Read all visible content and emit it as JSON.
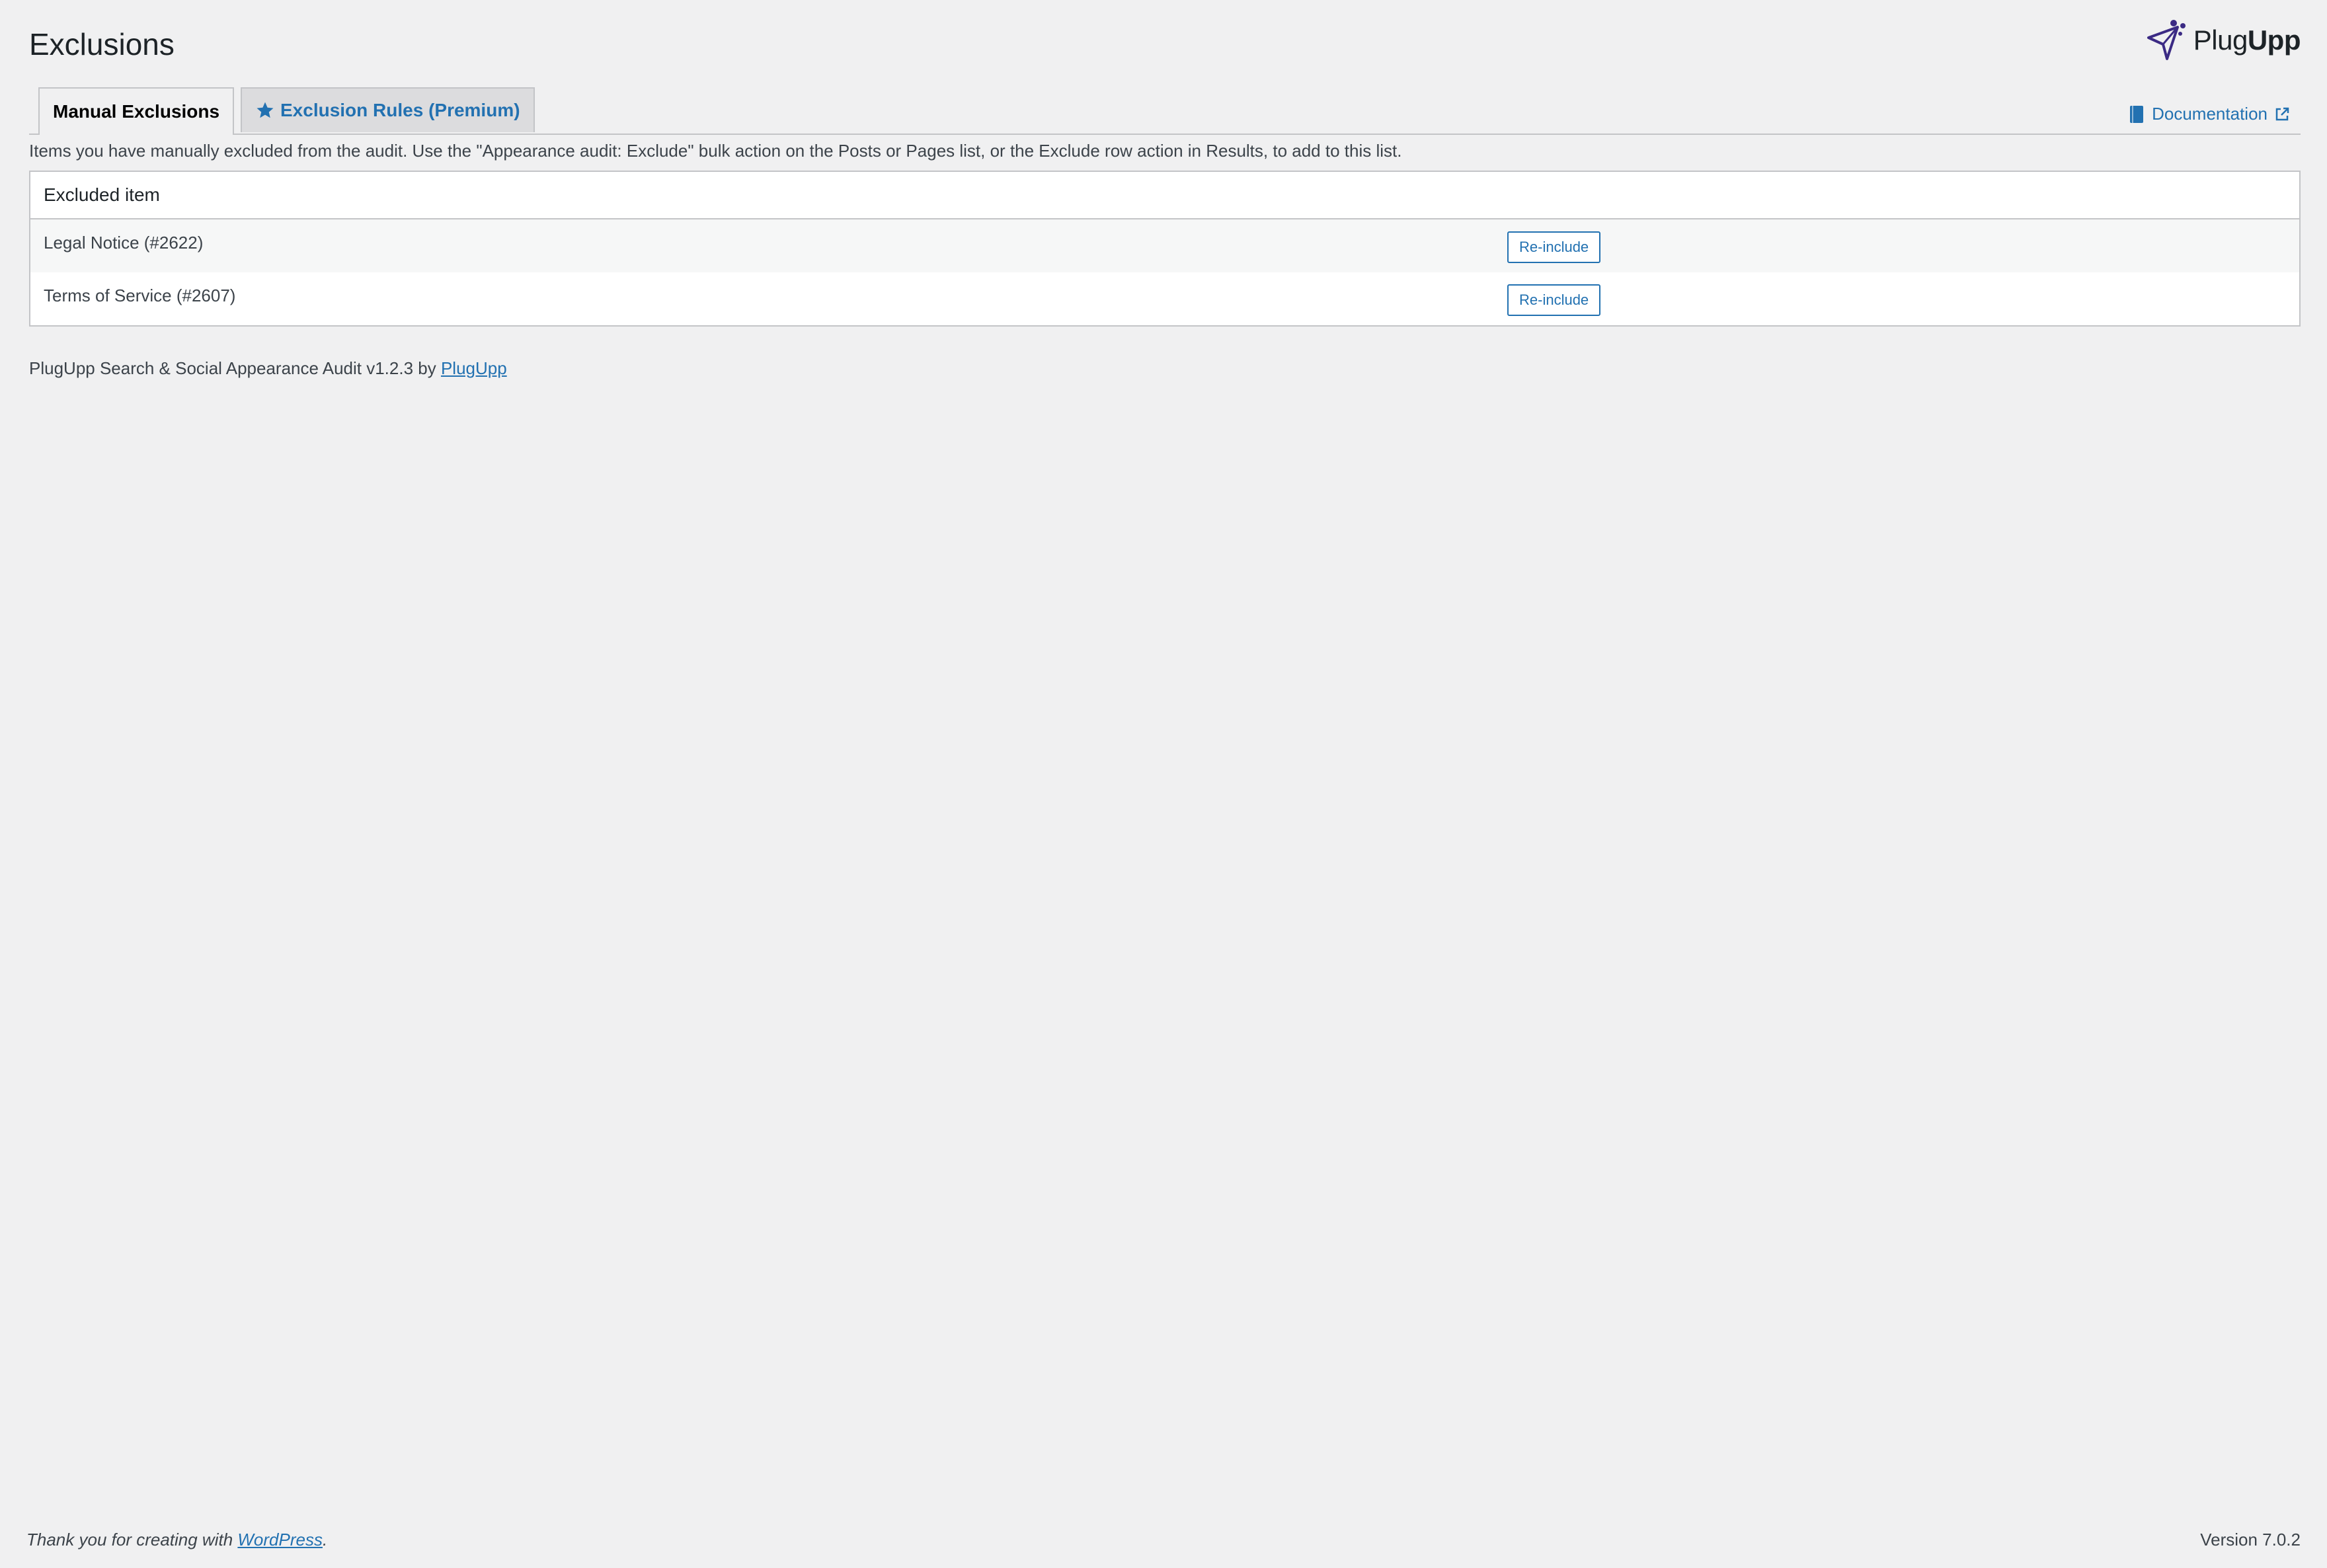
{
  "page": {
    "title": "Exclusions"
  },
  "brand": {
    "name_plain": "Plug",
    "name_bold": "Upp",
    "icon": "paper-plane-logo-icon",
    "accent_color": "#3b2a84"
  },
  "tabs": [
    {
      "label": "Manual Exclusions",
      "active": true
    },
    {
      "label": "Exclusion Rules (Premium)",
      "active": false,
      "icon": "star-icon"
    }
  ],
  "documentation": {
    "label": "Documentation",
    "icon": "book-icon",
    "trailing_icon": "external-link-icon"
  },
  "intro_text": "Items you have manually excluded from the audit. Use the \"Appearance audit: Exclude\" bulk action on the Posts or Pages list, or the Exclude row action in Results, to add to this list.",
  "table": {
    "header": "Excluded item",
    "rows": [
      {
        "name": "Legal Notice (#2622)",
        "action": "Re-include"
      },
      {
        "name": "Terms of Service (#2607)",
        "action": "Re-include"
      }
    ]
  },
  "plugin_footer": {
    "text": "PlugUpp Search & Social Appearance Audit v1.2.3 by ",
    "link": "PlugUpp"
  },
  "wp_footer": {
    "text": "Thank you for creating with ",
    "link": "WordPress",
    "suffix": ".",
    "version": "Version 7.0.2"
  },
  "colors": {
    "link": "#2271b1",
    "background": "#f0f0f1",
    "border": "#c3c4c7"
  }
}
